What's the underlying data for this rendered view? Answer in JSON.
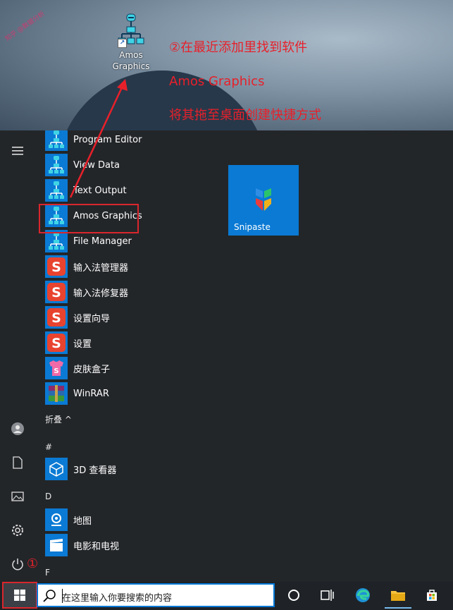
{
  "desktop": {
    "watermark": "知乎 @数据分析",
    "icon_label_line1": "Amos",
    "icon_label_line2": "Graphics",
    "annotation_line1": "②在最近添加里找到软件",
    "annotation_line2": "Amos Graphics",
    "annotation_line3": "将其拖至桌面创建快捷方式"
  },
  "start_menu": {
    "apps": [
      {
        "label": "Program Editor",
        "icon": "amos-tree-icon"
      },
      {
        "label": "View Data",
        "icon": "amos-tree-icon"
      },
      {
        "label": "Text Output",
        "icon": "amos-tree-icon"
      },
      {
        "label": "Amos Graphics",
        "icon": "amos-tree-icon"
      },
      {
        "label": "File Manager",
        "icon": "amos-tree-icon"
      },
      {
        "label": "输入法管理器",
        "icon": "sogou-icon"
      },
      {
        "label": "输入法修复器",
        "icon": "sogou-icon"
      },
      {
        "label": "设置向导",
        "icon": "sogou-icon"
      },
      {
        "label": "设置",
        "icon": "sogou-icon"
      },
      {
        "label": "皮肤盒子",
        "icon": "skin-box-icon"
      },
      {
        "label": "WinRAR",
        "icon": "winrar-icon"
      }
    ],
    "collapse_label": "折叠 ^",
    "section_hash": "#",
    "viewer_3d": "3D 查看器",
    "section_d": "D",
    "maps": "地图",
    "movies": "电影和电视",
    "section_f": "F",
    "tile_snipaste": "Snipaste",
    "step1_marker": "①"
  },
  "taskbar": {
    "search_placeholder": "在这里输入你要搜索的内容"
  },
  "colors": {
    "accent_blue": "#0a7ad4",
    "annotation_red": "#e8202a",
    "menu_bg": "#232629"
  }
}
